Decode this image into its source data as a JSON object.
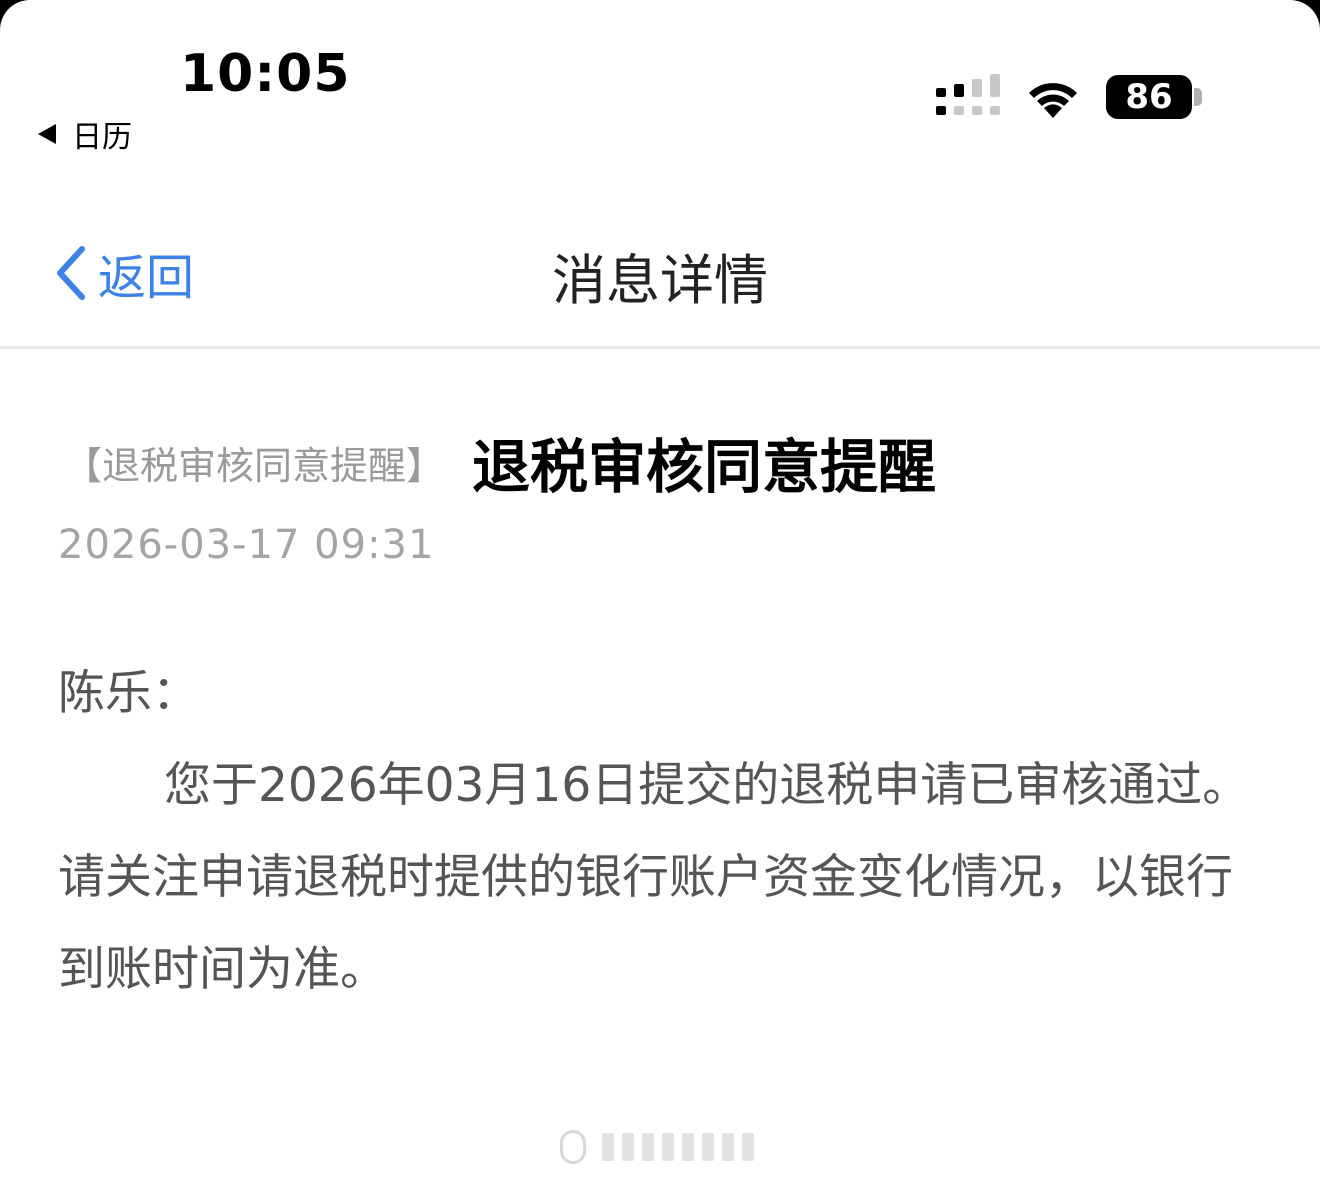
{
  "status_bar": {
    "time": "10:05",
    "back_app": "日历",
    "battery": "86"
  },
  "nav": {
    "back_label": "返回",
    "title": "消息详情"
  },
  "message": {
    "tag": "【退税审核同意提醒】",
    "title": "退税审核同意提醒",
    "date": "2026-03-17 09:31",
    "greeting": "陈乐：",
    "body": "您于2026年03月16日提交的退税申请已审核通过。请关注申请退税时提供的银行账户资金变化情况，以银行到账时间为准。"
  },
  "colors": {
    "accent": "#3f82e6",
    "muted": "#9a9a9a",
    "body_text": "#555555"
  },
  "icons": [
    "back-triangle-icon",
    "signal-icon",
    "wifi-icon",
    "battery-icon",
    "chevron-left-icon"
  ]
}
